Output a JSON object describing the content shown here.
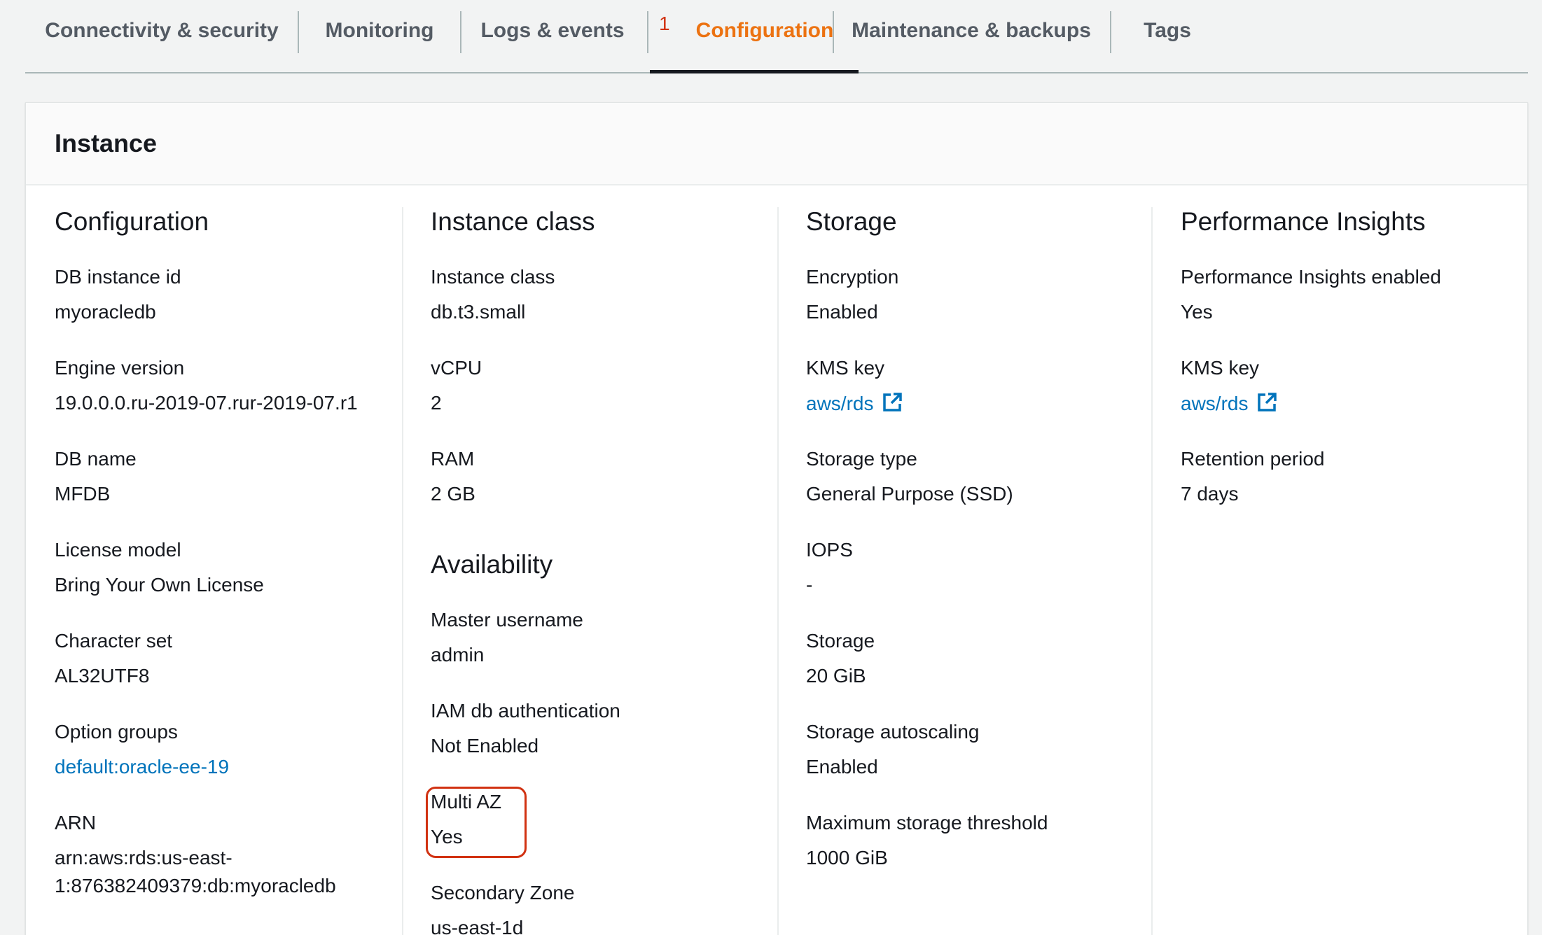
{
  "tabs": [
    {
      "label": "Connectivity & security"
    },
    {
      "label": "Monitoring"
    },
    {
      "label": "Logs & events"
    },
    {
      "label": "Configuration",
      "badge": "1",
      "active": true
    },
    {
      "label": "Maintenance & backups"
    },
    {
      "label": "Tags"
    }
  ],
  "panel": {
    "title": "Instance"
  },
  "configuration": {
    "heading": "Configuration",
    "db_instance_id": {
      "label": "DB instance id",
      "value": "myoracledb"
    },
    "engine_version": {
      "label": "Engine version",
      "value": "19.0.0.0.ru-2019-07.rur-2019-07.r1"
    },
    "db_name": {
      "label": "DB name",
      "value": "MFDB"
    },
    "license_model": {
      "label": "License model",
      "value": "Bring Your Own License"
    },
    "character_set": {
      "label": "Character set",
      "value": "AL32UTF8"
    },
    "option_groups": {
      "label": "Option groups",
      "value": "default:oracle-ee-19"
    },
    "arn": {
      "label": "ARN",
      "value_line1": "arn:aws:rds:us-east-",
      "value_line2": "1:876382409379:db:myoracledb"
    }
  },
  "instance_class": {
    "heading": "Instance class",
    "instance_class": {
      "label": "Instance class",
      "value": "db.t3.small"
    },
    "vcpu": {
      "label": "vCPU",
      "value": "2"
    },
    "ram": {
      "label": "RAM",
      "value": "2 GB"
    }
  },
  "availability": {
    "heading": "Availability",
    "master_username": {
      "label": "Master username",
      "value": "admin"
    },
    "iam_db_auth": {
      "label": "IAM db authentication",
      "value": "Not Enabled"
    },
    "multi_az": {
      "label": "Multi AZ",
      "value": "Yes"
    },
    "secondary_zone": {
      "label": "Secondary Zone",
      "value": "us-east-1d"
    }
  },
  "storage": {
    "heading": "Storage",
    "encryption": {
      "label": "Encryption",
      "value": "Enabled"
    },
    "kms_key": {
      "label": "KMS key",
      "value": "aws/rds"
    },
    "storage_type": {
      "label": "Storage type",
      "value": "General Purpose (SSD)"
    },
    "iops": {
      "label": "IOPS",
      "value": "-"
    },
    "storage": {
      "label": "Storage",
      "value": "20 GiB"
    },
    "autoscaling": {
      "label": "Storage autoscaling",
      "value": "Enabled"
    },
    "max_threshold": {
      "label": "Maximum storage threshold",
      "value": "1000 GiB"
    }
  },
  "performance_insights": {
    "heading": "Performance Insights",
    "enabled": {
      "label": "Performance Insights enabled",
      "value": "Yes"
    },
    "kms_key": {
      "label": "KMS key",
      "value": "aws/rds"
    },
    "retention": {
      "label": "Retention period",
      "value": "7 days"
    }
  },
  "colors": {
    "accent": "#ec7211",
    "link": "#0073bb",
    "highlight": "#d13212"
  }
}
